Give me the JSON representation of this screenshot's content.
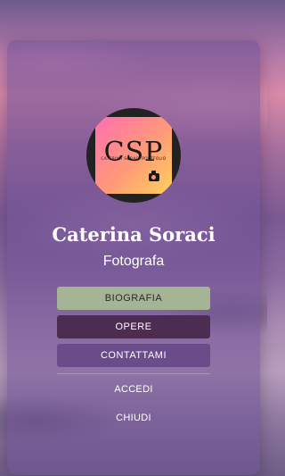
{
  "logo": {
    "monogram": "CSP",
    "subtitle": "CATERINA SORACI PORTFOLIO",
    "icon": "camera-icon"
  },
  "profile": {
    "name": "Caterina Soraci",
    "role": "Fotografa"
  },
  "menu": {
    "buttons": [
      {
        "label": "BIOGRAFIA",
        "color": "#a4b494"
      },
      {
        "label": "OPERE",
        "color": "#4d2c51"
      },
      {
        "label": "CONTATTAMI",
        "color": "#6a4c8b"
      }
    ],
    "links": [
      {
        "label": "ACCEDI"
      },
      {
        "label": "CHIUDI"
      }
    ]
  }
}
